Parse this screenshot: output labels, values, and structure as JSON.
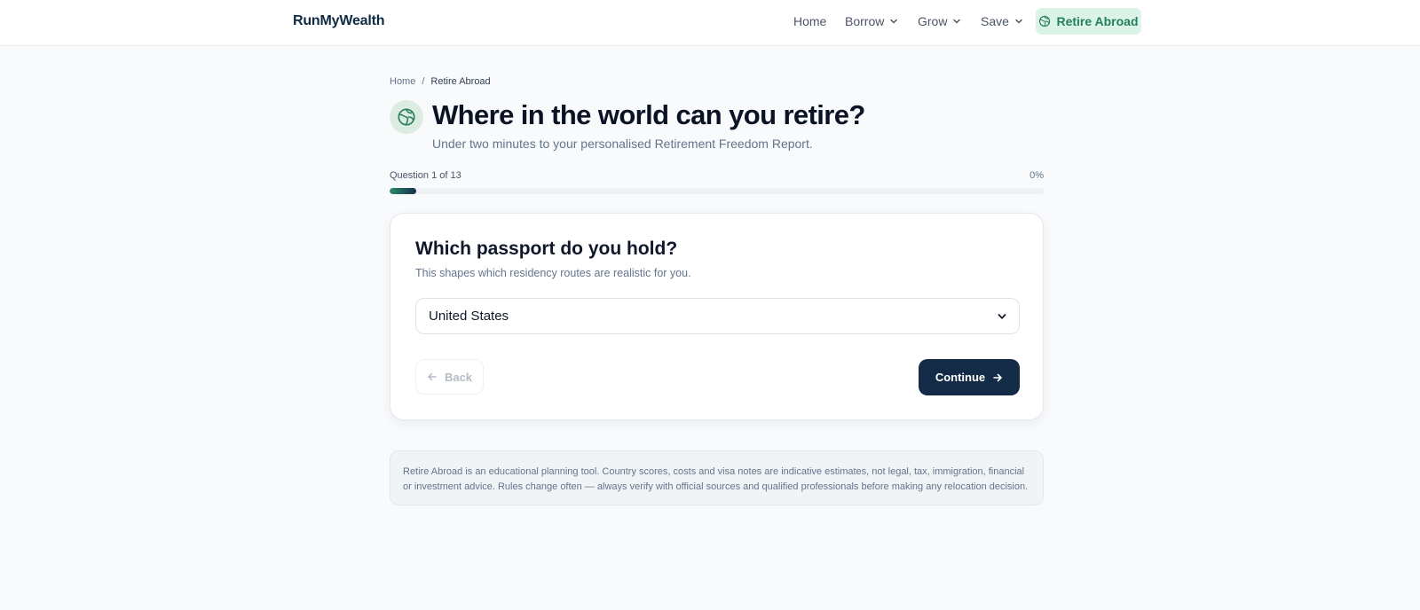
{
  "header": {
    "brand": "RunMyWealth",
    "nav": [
      {
        "label": "Home"
      },
      {
        "label": "Borrow"
      },
      {
        "label": "Grow"
      },
      {
        "label": "Save"
      }
    ],
    "cta_label": "Retire Abroad",
    "cta_icon": "globe-icon"
  },
  "breadcrumb": {
    "home": "Home",
    "separator": "/",
    "current": "Retire Abroad"
  },
  "hero": {
    "icon": "globe-icon",
    "title": "Where in the world can you retire?",
    "subtitle": "Under two minutes to your personalised Retirement Freedom Report."
  },
  "progress": {
    "label": "Question 1 of 13",
    "percent_label": "0%",
    "percent": 0
  },
  "question": {
    "title": "Which passport do you hold?",
    "hint": "This shapes which residency routes are realistic for you.",
    "selected_value": "United States",
    "back_label": "Back",
    "continue_label": "Continue"
  },
  "disclaimer": "Retire Abroad is an educational planning tool. Country scores, costs and visa notes are indicative estimates, not legal, tax, immigration, financial or investment advice. Rules change often — always verify with official sources and qualified professionals before making any relocation decision.",
  "colors": {
    "brand_navy": "#132b47",
    "accent_green": "#23805a",
    "accent_green_bg": "#dcf3e8",
    "page_bg": "#f8fafc"
  }
}
